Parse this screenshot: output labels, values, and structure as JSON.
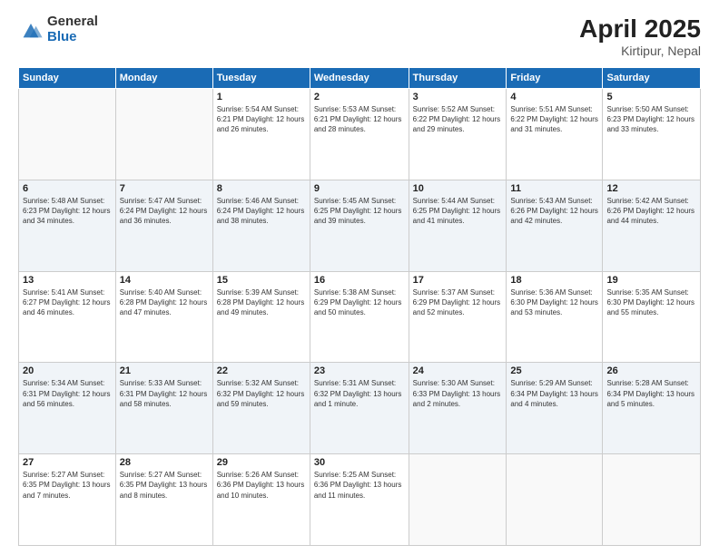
{
  "header": {
    "logo_general": "General",
    "logo_blue": "Blue",
    "month_year": "April 2025",
    "location": "Kirtipur, Nepal"
  },
  "days_of_week": [
    "Sunday",
    "Monday",
    "Tuesday",
    "Wednesday",
    "Thursday",
    "Friday",
    "Saturday"
  ],
  "weeks": [
    [
      {
        "day": "",
        "info": ""
      },
      {
        "day": "",
        "info": ""
      },
      {
        "day": "1",
        "info": "Sunrise: 5:54 AM\nSunset: 6:21 PM\nDaylight: 12 hours and 26 minutes."
      },
      {
        "day": "2",
        "info": "Sunrise: 5:53 AM\nSunset: 6:21 PM\nDaylight: 12 hours and 28 minutes."
      },
      {
        "day": "3",
        "info": "Sunrise: 5:52 AM\nSunset: 6:22 PM\nDaylight: 12 hours and 29 minutes."
      },
      {
        "day": "4",
        "info": "Sunrise: 5:51 AM\nSunset: 6:22 PM\nDaylight: 12 hours and 31 minutes."
      },
      {
        "day": "5",
        "info": "Sunrise: 5:50 AM\nSunset: 6:23 PM\nDaylight: 12 hours and 33 minutes."
      }
    ],
    [
      {
        "day": "6",
        "info": "Sunrise: 5:48 AM\nSunset: 6:23 PM\nDaylight: 12 hours and 34 minutes."
      },
      {
        "day": "7",
        "info": "Sunrise: 5:47 AM\nSunset: 6:24 PM\nDaylight: 12 hours and 36 minutes."
      },
      {
        "day": "8",
        "info": "Sunrise: 5:46 AM\nSunset: 6:24 PM\nDaylight: 12 hours and 38 minutes."
      },
      {
        "day": "9",
        "info": "Sunrise: 5:45 AM\nSunset: 6:25 PM\nDaylight: 12 hours and 39 minutes."
      },
      {
        "day": "10",
        "info": "Sunrise: 5:44 AM\nSunset: 6:25 PM\nDaylight: 12 hours and 41 minutes."
      },
      {
        "day": "11",
        "info": "Sunrise: 5:43 AM\nSunset: 6:26 PM\nDaylight: 12 hours and 42 minutes."
      },
      {
        "day": "12",
        "info": "Sunrise: 5:42 AM\nSunset: 6:26 PM\nDaylight: 12 hours and 44 minutes."
      }
    ],
    [
      {
        "day": "13",
        "info": "Sunrise: 5:41 AM\nSunset: 6:27 PM\nDaylight: 12 hours and 46 minutes."
      },
      {
        "day": "14",
        "info": "Sunrise: 5:40 AM\nSunset: 6:28 PM\nDaylight: 12 hours and 47 minutes."
      },
      {
        "day": "15",
        "info": "Sunrise: 5:39 AM\nSunset: 6:28 PM\nDaylight: 12 hours and 49 minutes."
      },
      {
        "day": "16",
        "info": "Sunrise: 5:38 AM\nSunset: 6:29 PM\nDaylight: 12 hours and 50 minutes."
      },
      {
        "day": "17",
        "info": "Sunrise: 5:37 AM\nSunset: 6:29 PM\nDaylight: 12 hours and 52 minutes."
      },
      {
        "day": "18",
        "info": "Sunrise: 5:36 AM\nSunset: 6:30 PM\nDaylight: 12 hours and 53 minutes."
      },
      {
        "day": "19",
        "info": "Sunrise: 5:35 AM\nSunset: 6:30 PM\nDaylight: 12 hours and 55 minutes."
      }
    ],
    [
      {
        "day": "20",
        "info": "Sunrise: 5:34 AM\nSunset: 6:31 PM\nDaylight: 12 hours and 56 minutes."
      },
      {
        "day": "21",
        "info": "Sunrise: 5:33 AM\nSunset: 6:31 PM\nDaylight: 12 hours and 58 minutes."
      },
      {
        "day": "22",
        "info": "Sunrise: 5:32 AM\nSunset: 6:32 PM\nDaylight: 12 hours and 59 minutes."
      },
      {
        "day": "23",
        "info": "Sunrise: 5:31 AM\nSunset: 6:32 PM\nDaylight: 13 hours and 1 minute."
      },
      {
        "day": "24",
        "info": "Sunrise: 5:30 AM\nSunset: 6:33 PM\nDaylight: 13 hours and 2 minutes."
      },
      {
        "day": "25",
        "info": "Sunrise: 5:29 AM\nSunset: 6:34 PM\nDaylight: 13 hours and 4 minutes."
      },
      {
        "day": "26",
        "info": "Sunrise: 5:28 AM\nSunset: 6:34 PM\nDaylight: 13 hours and 5 minutes."
      }
    ],
    [
      {
        "day": "27",
        "info": "Sunrise: 5:27 AM\nSunset: 6:35 PM\nDaylight: 13 hours and 7 minutes."
      },
      {
        "day": "28",
        "info": "Sunrise: 5:27 AM\nSunset: 6:35 PM\nDaylight: 13 hours and 8 minutes."
      },
      {
        "day": "29",
        "info": "Sunrise: 5:26 AM\nSunset: 6:36 PM\nDaylight: 13 hours and 10 minutes."
      },
      {
        "day": "30",
        "info": "Sunrise: 5:25 AM\nSunset: 6:36 PM\nDaylight: 13 hours and 11 minutes."
      },
      {
        "day": "",
        "info": ""
      },
      {
        "day": "",
        "info": ""
      },
      {
        "day": "",
        "info": ""
      }
    ]
  ]
}
